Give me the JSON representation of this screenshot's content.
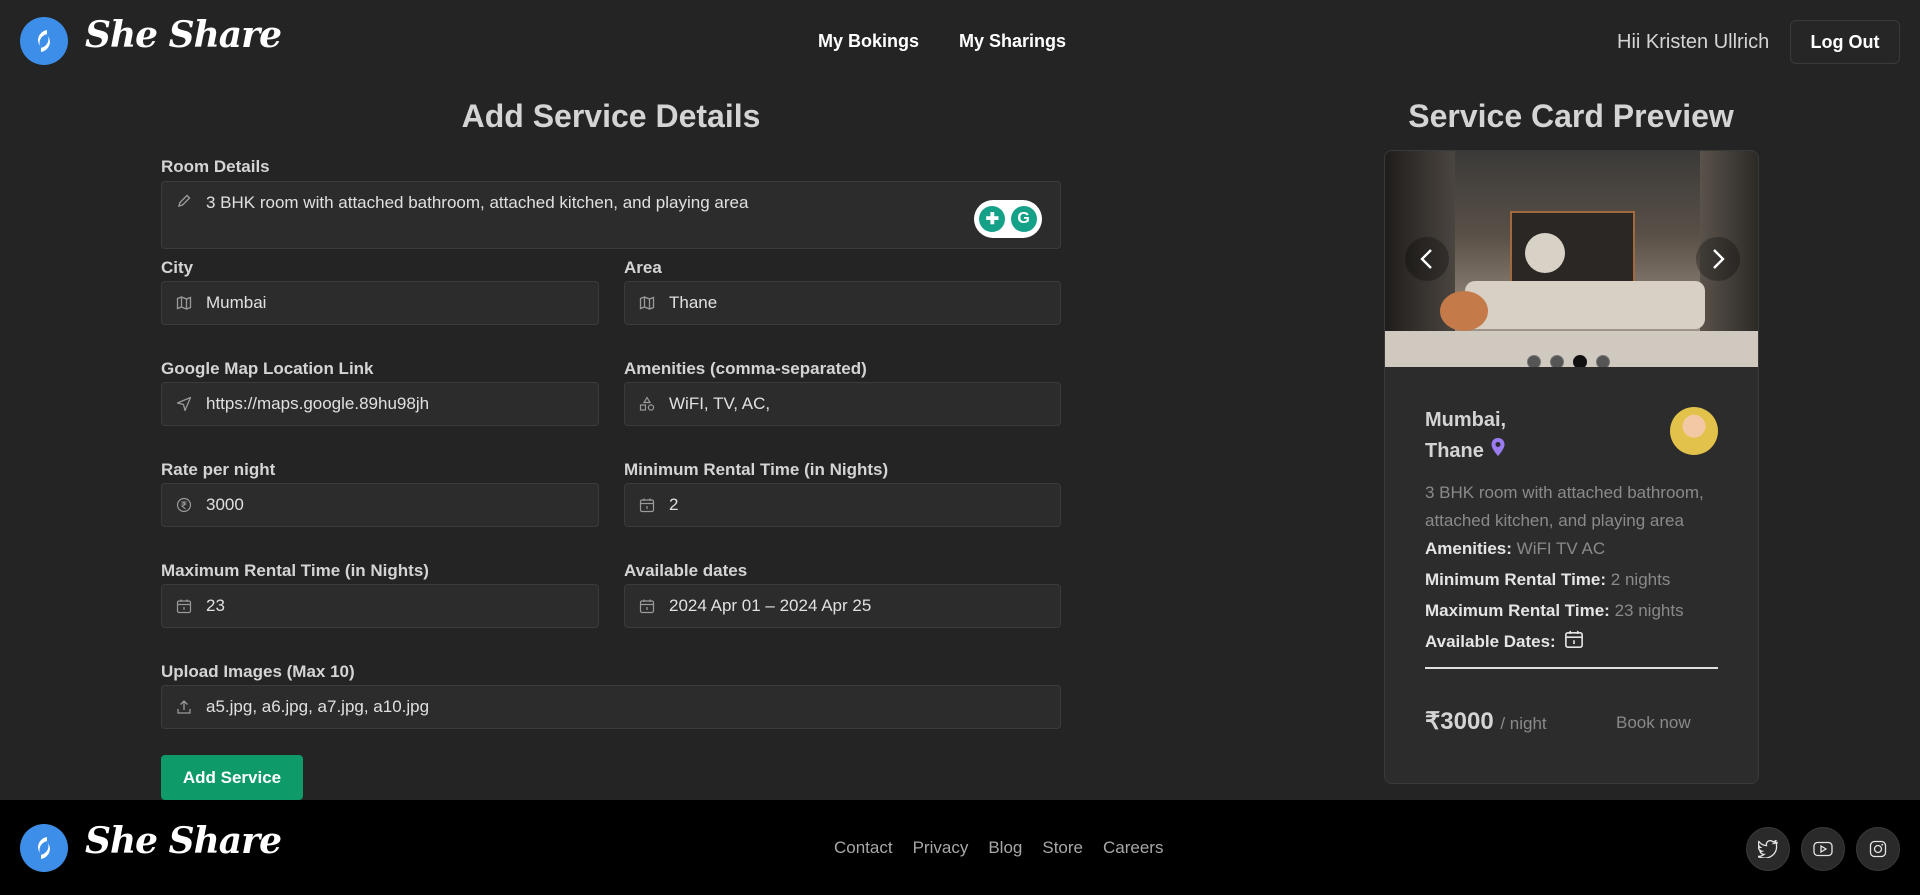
{
  "brand": {
    "name": "She Share"
  },
  "nav": {
    "bookings": "My Bokings",
    "sharings": "My Sharings"
  },
  "user": {
    "greeting": "Hii Kristen Ullrich",
    "logout": "Log Out"
  },
  "form": {
    "title": "Add Service Details",
    "room_details": {
      "label": "Room Details",
      "value": "3 BHK room with attached bathroom, attached kitchen, and playing area"
    },
    "city": {
      "label": "City",
      "value": "Mumbai"
    },
    "area": {
      "label": "Area",
      "value": "Thane"
    },
    "map_link": {
      "label": "Google Map Location Link",
      "value": "https://maps.google.89hu98jh"
    },
    "amenities": {
      "label": "Amenities (comma-separated)",
      "value": "WiFI, TV, AC,"
    },
    "rate": {
      "label": "Rate per night",
      "value": "3000"
    },
    "min_rental": {
      "label": "Minimum Rental Time (in Nights)",
      "value": "2"
    },
    "max_rental": {
      "label": "Maximum Rental Time (in Nights)",
      "value": "23"
    },
    "dates": {
      "label": "Available dates",
      "value": "2024 Apr 01 – 2024 Apr 25"
    },
    "images": {
      "label": "Upload Images (Max 10)",
      "value": "a5.jpg, a6.jpg, a7.jpg, a10.jpg"
    },
    "submit": "Add Service"
  },
  "preview": {
    "title": "Service Card Preview",
    "city": "Mumbai,",
    "area": "Thane",
    "description": "3 BHK room with attached bathroom, attached kitchen, and playing area",
    "amenities_label": "Amenities:",
    "amenities_value": "WiFI TV AC",
    "min_label": "Minimum Rental Time:",
    "min_value": "2 nights",
    "max_label": "Maximum Rental Time:",
    "max_value": "23 nights",
    "dates_label": "Available Dates:",
    "price": "₹3000",
    "price_unit": "/ night",
    "book": "Book now",
    "carousel_active": 3,
    "carousel_count": 4
  },
  "footer": {
    "links": [
      "Contact",
      "Privacy",
      "Blog",
      "Store",
      "Careers"
    ]
  },
  "colors": {
    "accent": "#0f9a6a",
    "logo": "#3d8ee8",
    "pin": "#9b7cf0"
  },
  "icons": [
    "pencil-icon",
    "map-icon",
    "send-icon",
    "shapes-icon",
    "rupee-icon",
    "calendar-icon",
    "upload-icon",
    "chevron-left-icon",
    "chevron-right-icon",
    "location-pin-icon",
    "twitter-icon",
    "youtube-icon",
    "instagram-icon"
  ]
}
